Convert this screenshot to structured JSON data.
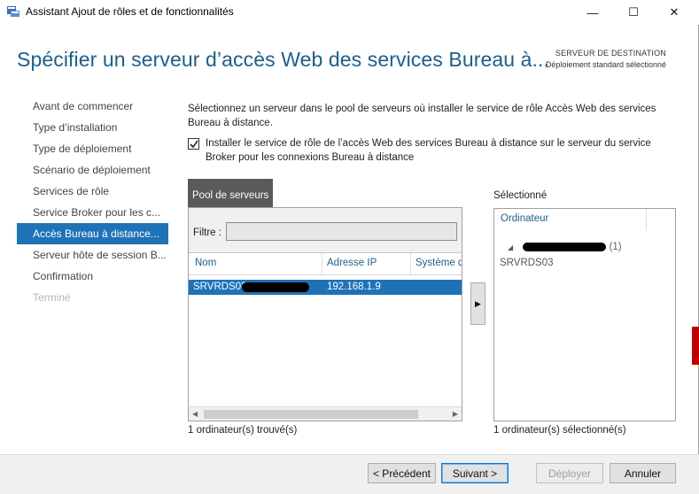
{
  "window": {
    "title": "Assistant Ajout de rôles et de fonctionnalités",
    "minimize_glyph": "—",
    "maximize_glyph": "☐",
    "close_glyph": "✕"
  },
  "header": {
    "page_title": "Spécifier un serveur d’accès Web des services Bureau à...",
    "destination_title": "SERVEUR DE DESTINATION",
    "destination_value": "Déploiement standard sélectionné"
  },
  "sidebar": {
    "items": [
      {
        "label": "Avant de commencer",
        "state": "normal"
      },
      {
        "label": "Type d’installation",
        "state": "normal"
      },
      {
        "label": "Type de déploiement",
        "state": "normal"
      },
      {
        "label": "Scénario de déploiement",
        "state": "normal"
      },
      {
        "label": "Services de rôle",
        "state": "normal"
      },
      {
        "label": "Service Broker pour les c...",
        "state": "normal"
      },
      {
        "label": "Accès Bureau à distance...",
        "state": "active"
      },
      {
        "label": "Serveur hôte de session B...",
        "state": "normal"
      },
      {
        "label": "Confirmation",
        "state": "normal"
      },
      {
        "label": "Terminé",
        "state": "disabled"
      }
    ]
  },
  "content": {
    "intro": "Sélectionnez un serveur dans le pool de serveurs où installer le service de rôle Accès Web des services Bureau à distance.",
    "checkbox_checked": true,
    "checkbox_label": "Installer le service de rôle de l’accès Web des services Bureau à distance sur le serveur du service Broker pour les connexions Bureau à distance"
  },
  "pool": {
    "tab_label": "Pool de serveurs",
    "filter_label": "Filtre :",
    "filter_value": "",
    "columns": [
      "Nom",
      "Adresse IP",
      "Système d"
    ],
    "rows": [
      {
        "name": "SRVRDS03",
        "ip": "192.168.1.9",
        "os": "",
        "selected": true
      }
    ],
    "count_text": "1 ordinateur(s) trouvé(s)"
  },
  "move_button": {
    "glyph": "▶"
  },
  "selected": {
    "label": "Sélectionné",
    "column": "Ordinateur",
    "group_count": "(1)",
    "items": [
      "SRVRDS03"
    ],
    "count_text": "1 ordinateur(s) sélectionné(s)"
  },
  "buttons": {
    "previous": "< Précédent",
    "next": "Suivant >",
    "deploy": "Déployer",
    "cancel": "Annuler"
  },
  "colors": {
    "accent": "#1e72b8",
    "title_blue": "#1a5f8e",
    "tab_dark": "#5a5a5a"
  }
}
